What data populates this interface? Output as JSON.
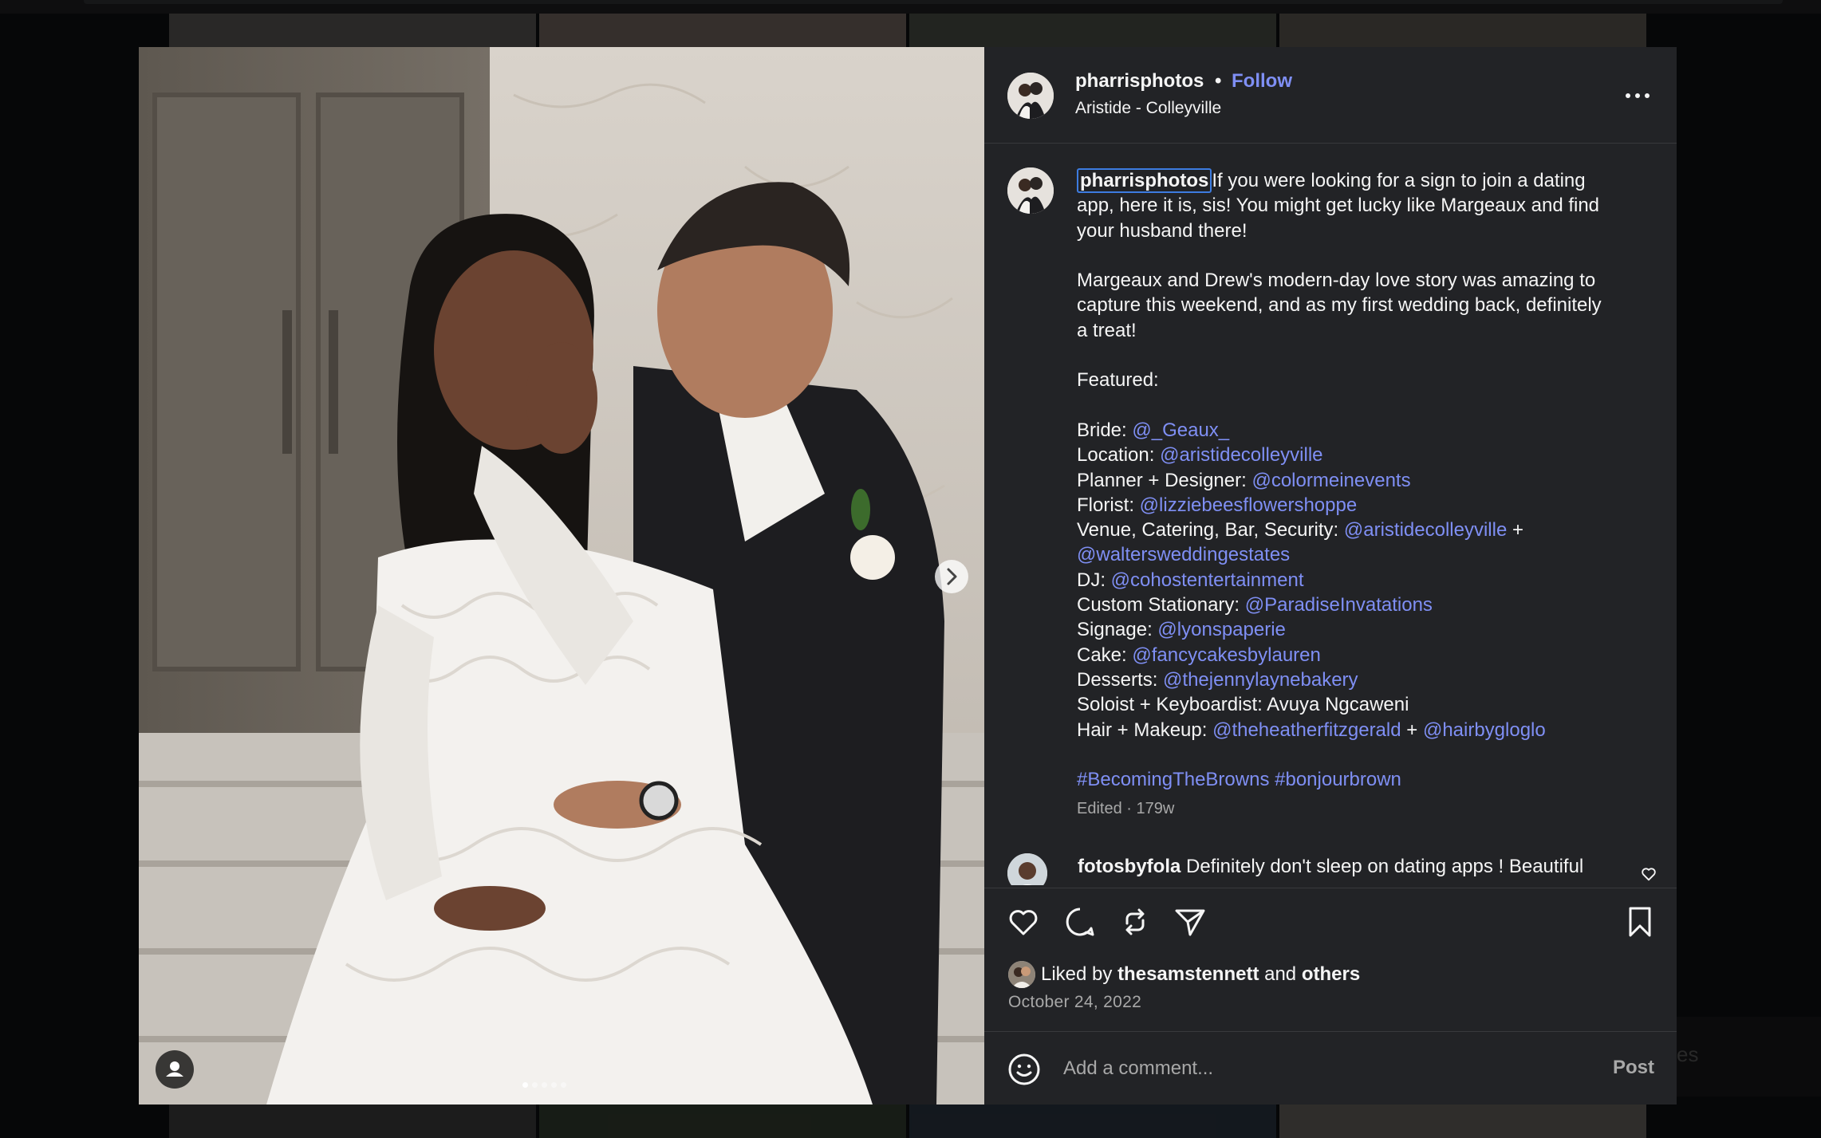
{
  "post": {
    "username": "pharrisphotos",
    "separator": "•",
    "follow_label": "Follow",
    "location": "Aristide - Colleyville",
    "more_label": "More options"
  },
  "caption": {
    "author": "pharrisphotos",
    "line1_rest": "If you were looking for a sign to join a dating",
    "line2": "app, here it is, sis! You might get lucky like Margeaux and find",
    "line3": "your husband there!",
    "p2_line1": "Margeaux and Drew's modern-day love story was amazing to",
    "p2_line2": "capture this weekend, and as my first wedding back, definitely",
    "p2_line3": "a treat!",
    "featured": "Featured:",
    "credits": [
      {
        "label": "Bride: ",
        "handle": "@_Geaux_"
      },
      {
        "label": "Location: ",
        "handle": "@aristidecolleyville"
      },
      {
        "label": "Planner + Designer: ",
        "handle": "@colormeinevents"
      },
      {
        "label": "Florist: ",
        "handle": "@lizziebeesflowershoppe"
      },
      {
        "label": "Venue, Catering, Bar, Security: ",
        "handle": "@aristidecolleyville",
        "suffix": " +"
      },
      {
        "label": "",
        "handle": "@waltersweddingestates"
      },
      {
        "label": "DJ: ",
        "handle": "@cohostentertainment"
      },
      {
        "label": "Custom Stationary: ",
        "handle": "@ParadiseInvatations"
      },
      {
        "label": "Signage: ",
        "handle": "@lyonspaperie"
      },
      {
        "label": "Cake: ",
        "handle": "@fancycakesbylauren"
      },
      {
        "label": "Desserts: ",
        "handle": "@thejennylaynebakery"
      },
      {
        "label": "Soloist + Keyboardist: Avuya Ngcaweni",
        "handle": ""
      },
      {
        "label": "Hair + Makeup: ",
        "handle": "@theheatherfitzgerald",
        "suffix": " + ",
        "handle2": "@hairbygloglo"
      }
    ],
    "hashtags": [
      "#BecomingTheBrowns",
      "#bonjourbrown"
    ],
    "edited": "Edited · 179w"
  },
  "comment": {
    "username": "fotosbyfola",
    "text": " Definitely don't sleep on dating apps ! Beautiful"
  },
  "actions": {
    "like": "Like",
    "comment": "Comment",
    "repost": "Repost",
    "share": "Share",
    "save": "Save"
  },
  "likes": {
    "prefix": "Liked by ",
    "user": "thesamstennett",
    "middle": " and ",
    "others": "others"
  },
  "date": "October 24, 2022",
  "composer": {
    "placeholder": "Add a comment...",
    "post_label": "Post"
  },
  "carousel": {
    "slide_count": 5,
    "active_index": 0
  },
  "background_snippet": "es",
  "colors": {
    "modal_bg": "#222326",
    "link": "#7f8ff4",
    "muted": "#a8a8a8",
    "text": "#f5f5f5"
  }
}
